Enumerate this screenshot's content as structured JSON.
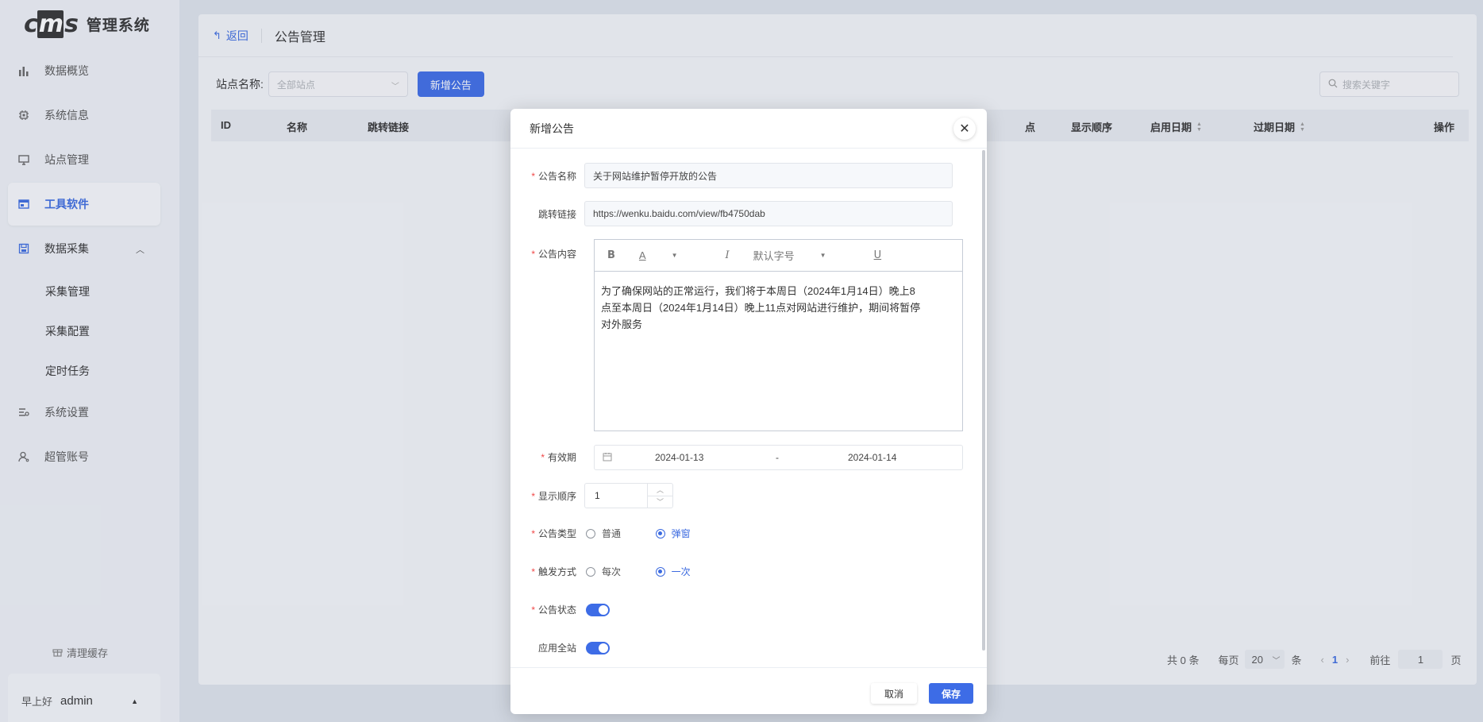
{
  "app": {
    "logo_mark": "cms",
    "logo_text": "管理系统"
  },
  "sidebar": {
    "items": [
      {
        "label": "数据概览",
        "icon": "bar-chart-icon"
      },
      {
        "label": "系统信息",
        "icon": "chip-icon"
      },
      {
        "label": "站点管理",
        "icon": "monitor-icon"
      },
      {
        "label": "工具软件",
        "icon": "window-icon",
        "active": true
      },
      {
        "label": "数据采集",
        "icon": "save-icon",
        "expanded": true
      },
      {
        "label": "系统设置",
        "icon": "settings-list-icon"
      },
      {
        "label": "超管账号",
        "icon": "user-icon"
      }
    ],
    "sub_items": [
      "采集管理",
      "采集配置",
      "定时任务"
    ],
    "clear_cache": "清理缓存",
    "greeting": "早上好",
    "username": "admin"
  },
  "header": {
    "back": "返回",
    "title": "公告管理"
  },
  "filters": {
    "site_label": "站点名称:",
    "site_placeholder": "全部站点",
    "add_button": "新增公告",
    "search_placeholder": "搜索关键字"
  },
  "table": {
    "columns": [
      "ID",
      "名称",
      "跳转链接",
      "点",
      "显示顺序",
      "启用日期",
      "过期日期",
      "操作"
    ]
  },
  "pagination": {
    "total": "共 0 条",
    "per_page_label": "每页",
    "per_page": "20",
    "per_page_unit": "条",
    "current": "1",
    "goto_label": "前往",
    "goto_value": "1",
    "goto_unit": "页"
  },
  "dialog": {
    "title": "新增公告",
    "name_label": "公告名称",
    "name_value": "关于网站维护暂停开放的公告",
    "link_label": "跳转链接",
    "link_value": "https://wenku.baidu.com/view/fb4750dab",
    "content_label": "公告内容",
    "toolbar": {
      "bold": "B",
      "color": "A",
      "italic": "I",
      "font_size": "默认字号",
      "underline": "U"
    },
    "content_lines": [
      "为了确保网站的正常运行，我们将于本周日（2024年1月14日）晚上8",
      "点至本周日（2024年1月14日）晚上11点对网站进行维护，期间将暂停",
      "对外服务"
    ],
    "validity_label": "有效期",
    "start_date": "2024-01-13",
    "date_sep": "-",
    "end_date": "2024-01-14",
    "order_label": "显示顺序",
    "order_value": "1",
    "type_label": "公告类型",
    "type_options": [
      "普通",
      "弹窗"
    ],
    "type_selected": "弹窗",
    "trigger_label": "触发方式",
    "trigger_options": [
      "每次",
      "一次"
    ],
    "trigger_selected": "一次",
    "status_label": "公告状态",
    "status_on": true,
    "all_sites_label": "应用全站",
    "all_sites_on": true,
    "cancel": "取消",
    "save": "保存"
  },
  "colors": {
    "primary": "#3d6ce6",
    "required": "#f04848"
  }
}
